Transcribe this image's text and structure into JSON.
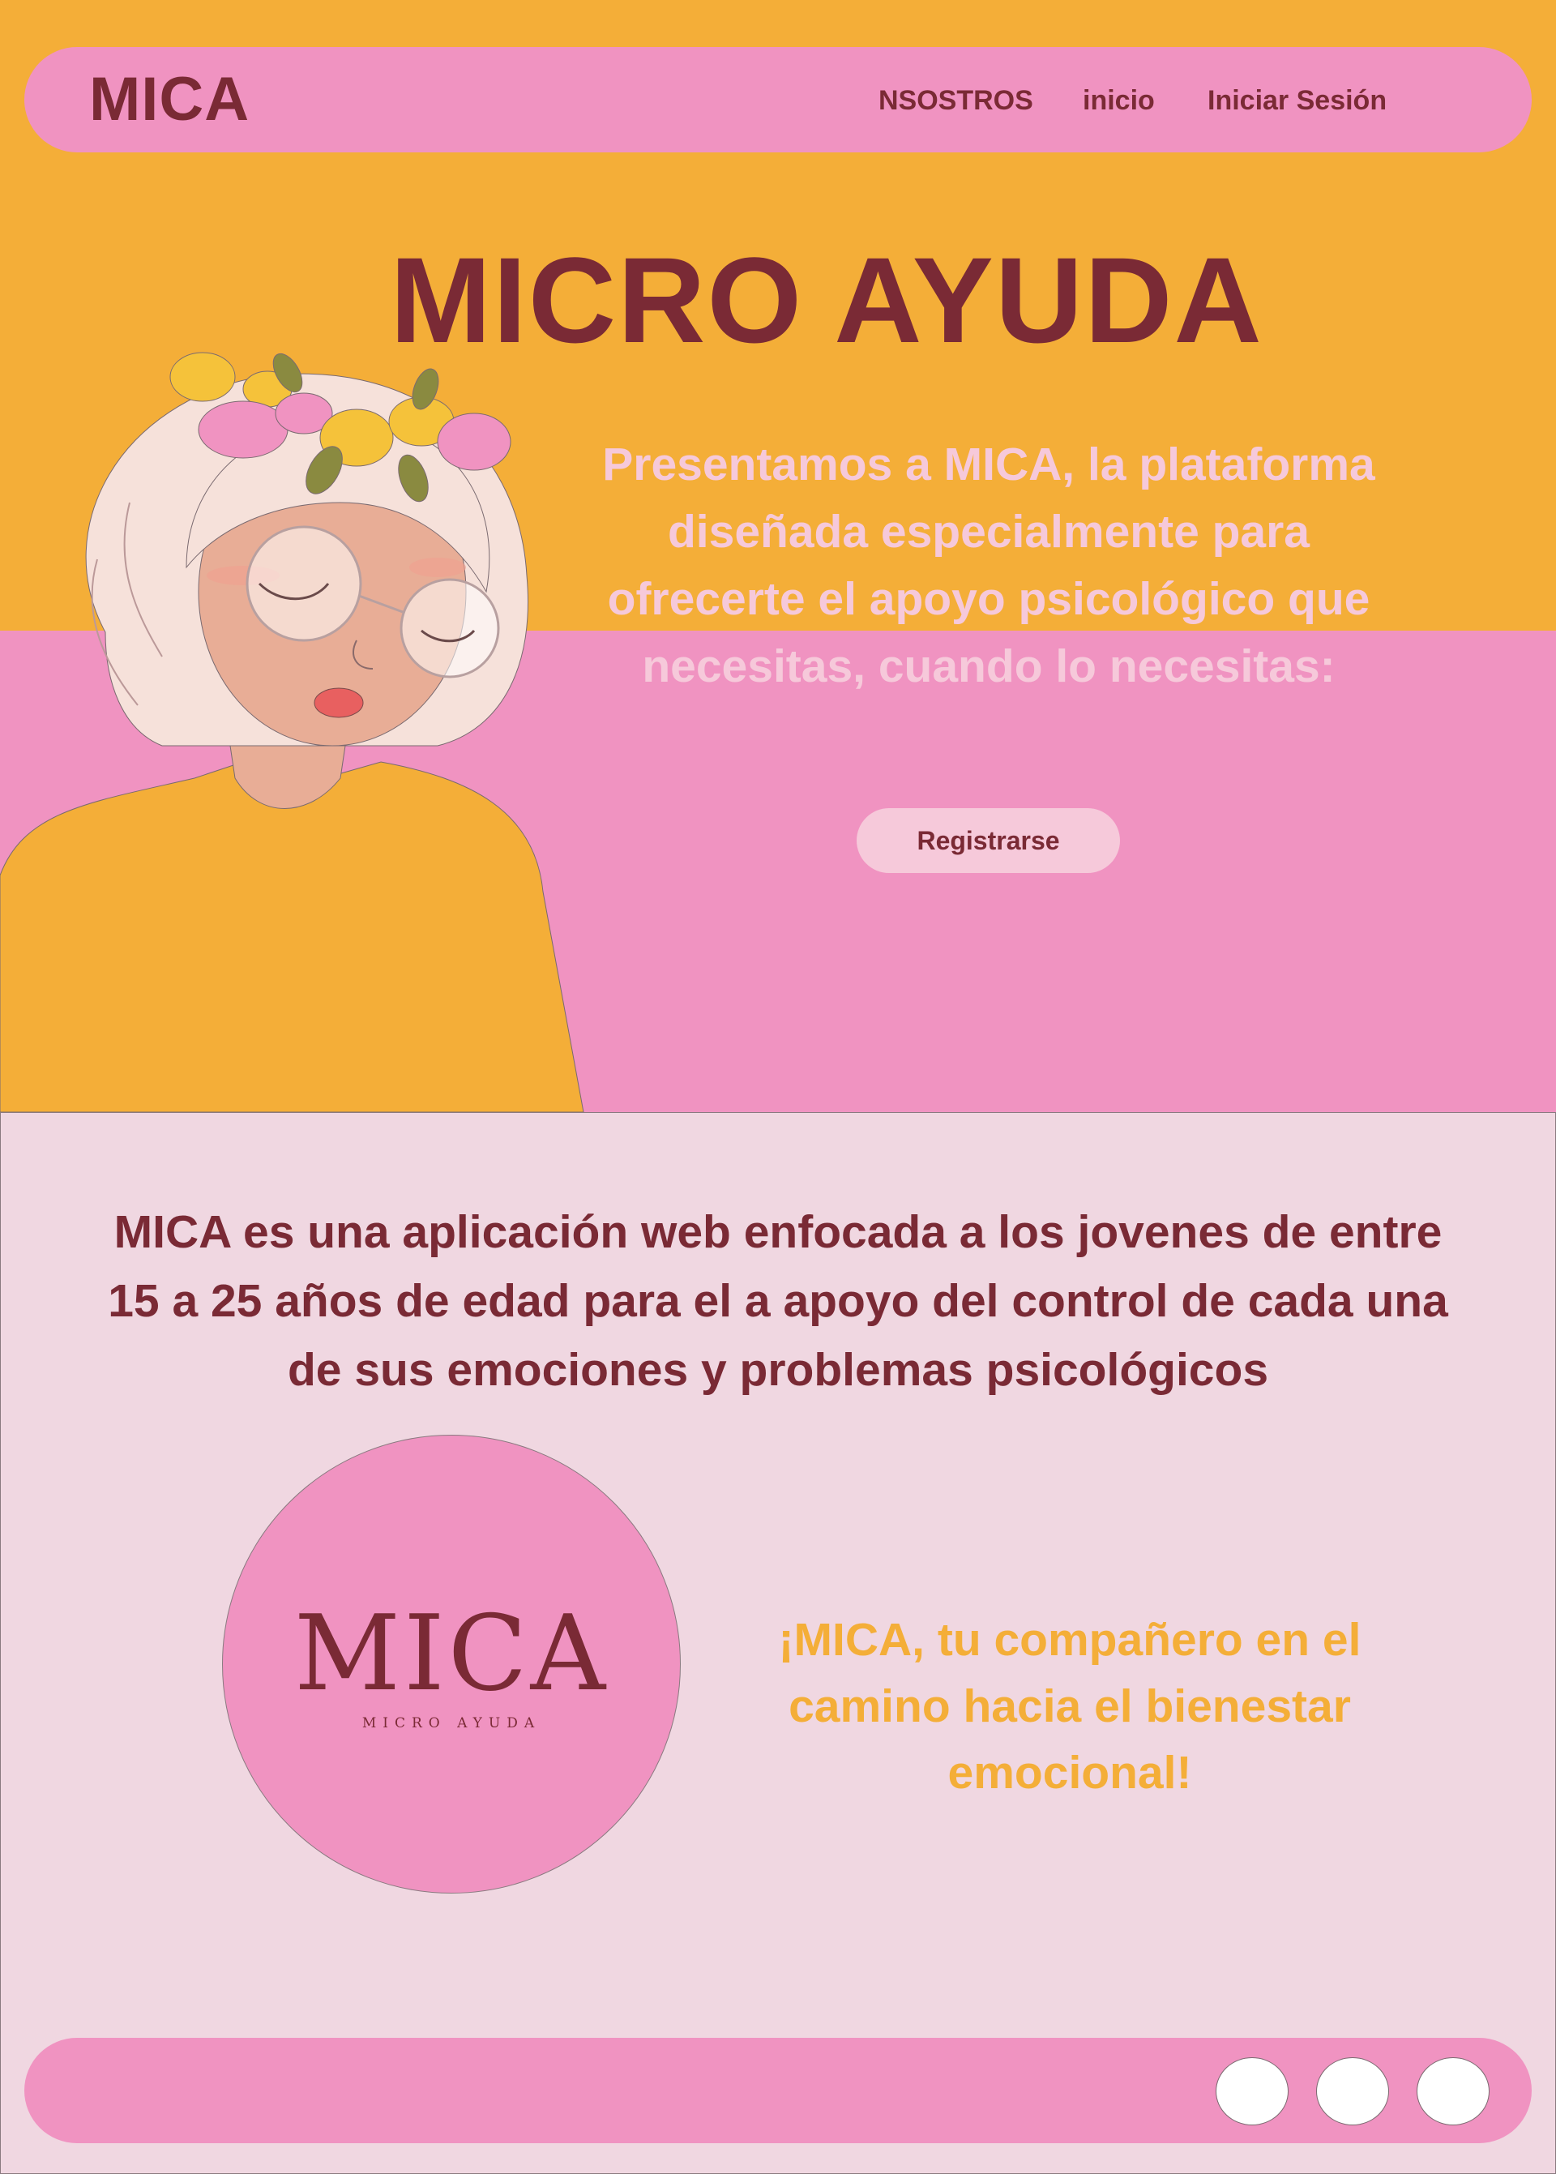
{
  "navbar": {
    "brand": "MICA",
    "items": [
      "NSOSTROS",
      "inicio",
      "Iniciar Sesión"
    ]
  },
  "hero": {
    "title": "MICRO AYUDA",
    "text": "Presentamos a MICA, la plataforma diseñada especialmente para ofrecerte el apoyo psicológico que necesitas, cuando lo necesitas:",
    "register_label": "Registrarse"
  },
  "about": {
    "text": "MICA es una aplicación web enfocada a los jovenes de entre 15 a 25 años de edad para el a apoyo del control de cada una de sus emociones y problemas psicológicos"
  },
  "logo": {
    "mark": "MICA",
    "subtitle": "MICRO AYUDA"
  },
  "tagline": "¡MICA, tu compañero en el camino hacia el bienestar emocional!",
  "footer": {
    "social_buttons": 3
  },
  "colors": {
    "orange": "#f4ae38",
    "pink": "#f093c1",
    "light_pink": "#f0d7e1",
    "maroon": "#7a2a35",
    "pale_pink_text": "#f6c9da"
  }
}
